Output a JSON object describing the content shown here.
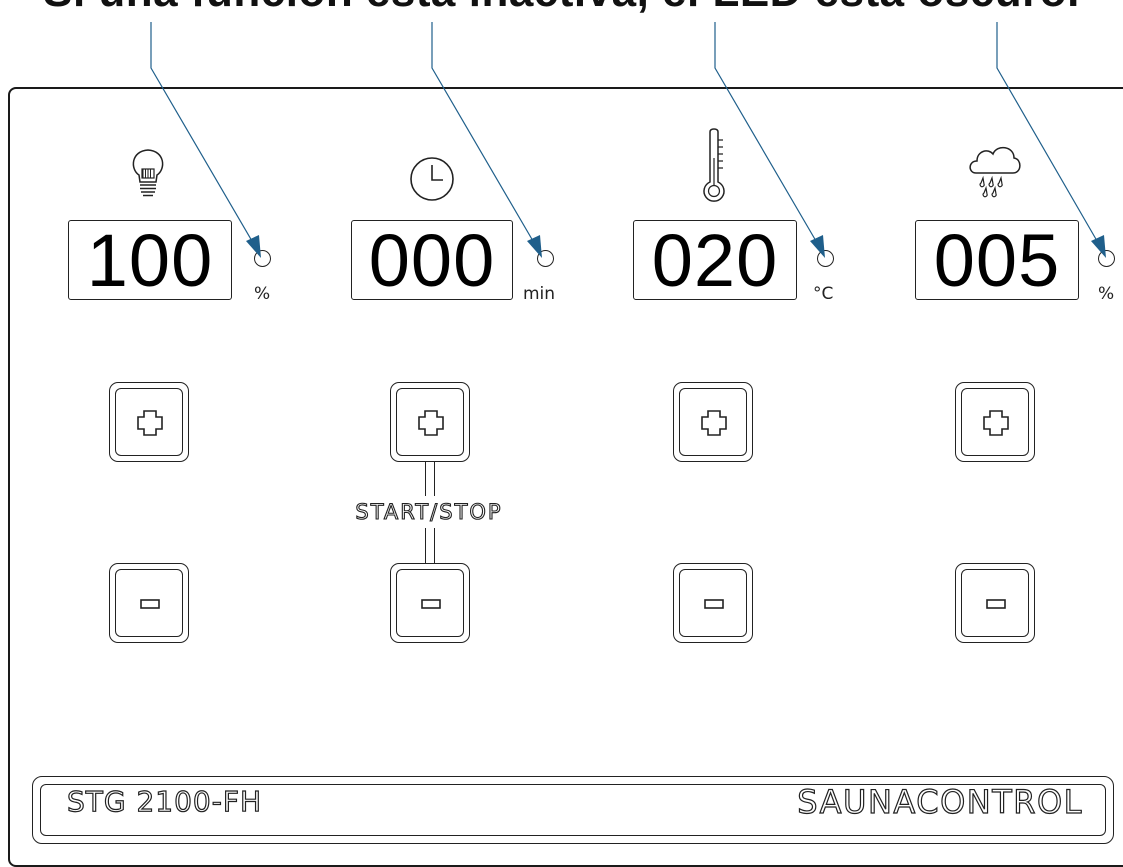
{
  "caption": "Si una función está inactiva, el LED está oscuro.",
  "colors": {
    "pointer": "#1f5f8b",
    "outline": "#222222"
  },
  "channels": [
    {
      "name": "light",
      "icon": "bulb-icon",
      "value": "100",
      "unit": "%"
    },
    {
      "name": "timer",
      "icon": "clock-icon",
      "value": "000",
      "unit": "min"
    },
    {
      "name": "temperature",
      "icon": "thermometer-icon",
      "value": "020",
      "unit": "°C"
    },
    {
      "name": "humidity",
      "icon": "rain-cloud-icon",
      "value": "005",
      "unit": "%"
    }
  ],
  "keys": {
    "plus_icon": "plus-icon",
    "minus_icon": "minus-icon"
  },
  "start_stop_label": "START/STOP",
  "footer": {
    "model": "STG 2100-FH",
    "brand": "SAUNACONTROL"
  }
}
